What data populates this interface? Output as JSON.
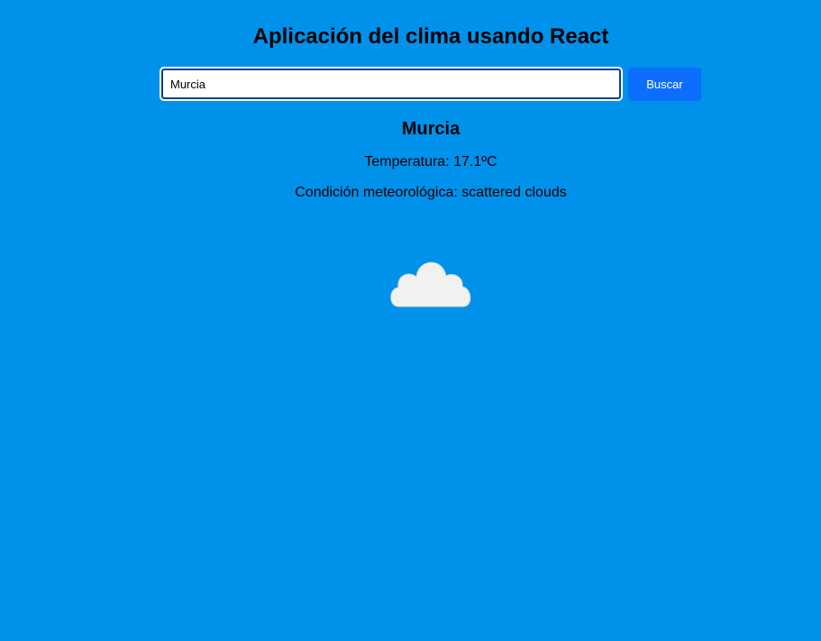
{
  "app": {
    "title": "Aplicación del clima usando React"
  },
  "search": {
    "value": "Murcia",
    "button_label": "Buscar"
  },
  "weather": {
    "city": "Murcia",
    "temperature_line": "Temperatura: 17.1ºC",
    "condition_line": "Condición meteorológica: scattered clouds",
    "icon": "cloud-icon"
  },
  "colors": {
    "background": "#0091ea",
    "button": "#0d6efd",
    "cloud": "#f1f1ef"
  }
}
